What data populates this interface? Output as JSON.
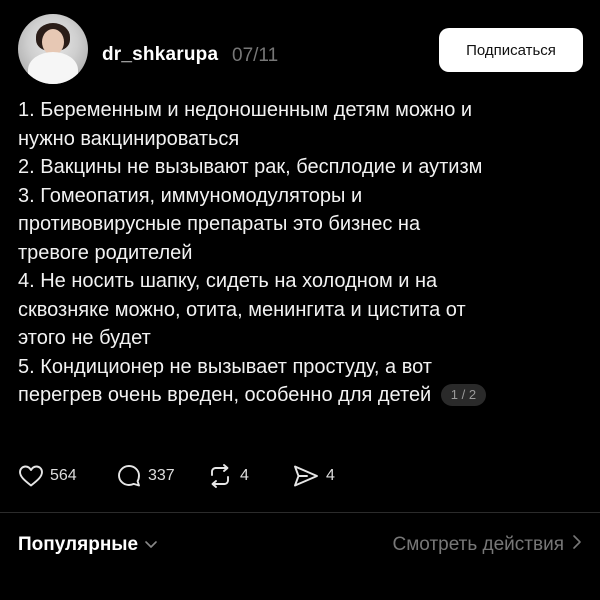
{
  "post": {
    "username": "dr_shkarupa",
    "date": "07/11",
    "follow_label": "Подписаться",
    "lines": [
      "1. Беременным и недоношенным детям можно и",
      "нужно вакцинироваться",
      "2. Вакцины не вызывают рак, бесплодие и аутизм",
      "3. Гомеопатия, иммуномодуляторы и",
      "противовирусные препараты это бизнес на",
      "тревоге родителей",
      "4. Не носить шапку, сидеть на холодном и на",
      "сквозняке можно, отита, менингита и цистита от",
      "этого не будет",
      "5. Кондиционер не вызывает простуду, а вот",
      "перегрев очень вреден, особенно для детей"
    ],
    "page_indicator": "1 / 2"
  },
  "actions": {
    "likes": "564",
    "comments": "337",
    "reposts": "4",
    "shares": "4"
  },
  "footer": {
    "popular_label": "Популярные",
    "activity_label": "Смотреть действия"
  },
  "icons": {
    "like": "heart-icon",
    "comment": "comment-bubble-icon",
    "repost": "repost-arrows-icon",
    "share": "send-icon",
    "dropdown": "chevron-down-icon",
    "more": "chevron-right-icon"
  }
}
